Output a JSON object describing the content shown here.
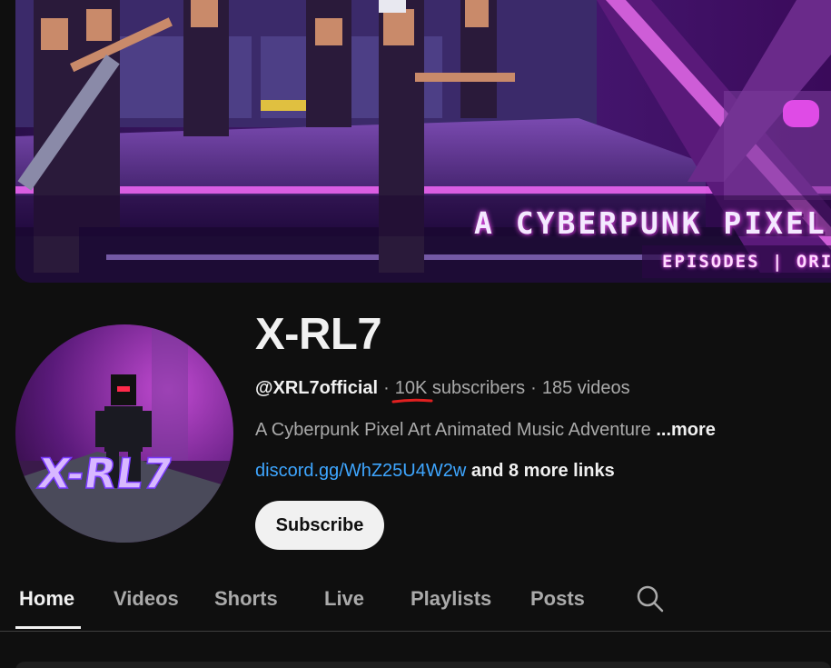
{
  "banner": {
    "title": "A CYBERPUNK PIXEL AR",
    "subtitle": "EPISODES | ORIGIN"
  },
  "channel": {
    "name": "X-RL7",
    "handle": "@XRL7official",
    "subscriber_count": "10K",
    "subscriber_label": "subscribers",
    "video_count": "185 videos",
    "separator": "·",
    "description": "A Cyberpunk Pixel Art Animated Music Adventure",
    "description_more": "...more",
    "link": "discord.gg/WhZ25U4W2w",
    "more_links": "and 8 more links",
    "subscribe_label": "Subscribe",
    "avatar_logo_text": "X-RL7"
  },
  "tabs": [
    {
      "label": "Home",
      "active": true
    },
    {
      "label": "Videos",
      "active": false
    },
    {
      "label": "Shorts",
      "active": false
    },
    {
      "label": "Live",
      "active": false
    },
    {
      "label": "Playlists",
      "active": false
    },
    {
      "label": "Posts",
      "active": false
    }
  ],
  "icons": {
    "search": "search-icon"
  },
  "colors": {
    "background": "#0f0f0f",
    "link": "#3ea6ff",
    "annotation": "#e02020",
    "banner_accent": "#c040ff"
  }
}
